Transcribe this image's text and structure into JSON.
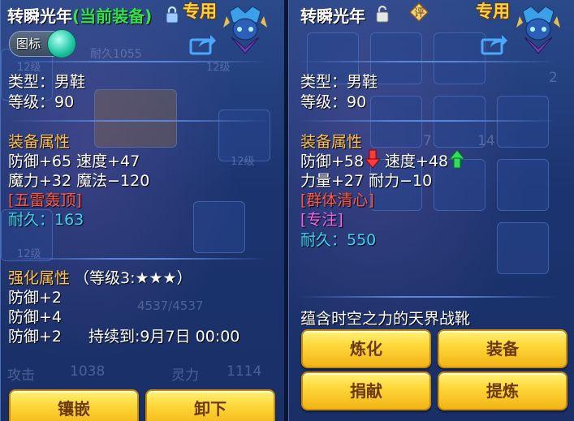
{
  "left_panel": {
    "item_name": "转瞬光年",
    "equipped_tag": "(当前装备)",
    "exclusive_tag": "专用",
    "icon_toggle_label": "图标",
    "type_line": "类型：男鞋",
    "level_line": "等级：90",
    "attr_title": "装备属性",
    "attr_line1": "防御+65 速度+47",
    "attr_line2": "魔力+32 魔法−120",
    "skill": "[五雷轰顶]",
    "durability": "耐久：163",
    "enhance_title": "强化属性",
    "enhance_level": "（等级3:★★★）",
    "enhance_lines": [
      "防御+2",
      "防御+4",
      "防御+2"
    ],
    "duration_text": "持续到:9月7日 00:00",
    "buttons": {
      "inlay": "镶嵌",
      "unequip": "卸下"
    },
    "background_text": [
      "12级",
      "12级",
      "12级",
      "12级",
      "4537/4537",
      "攻击",
      "1038",
      "灵力",
      "1114",
      "耐久1055"
    ]
  },
  "right_panel": {
    "item_name": "转瞬光年",
    "rate_icon_char": "评",
    "exclusive_tag": "专用",
    "type_line": "类型：男鞋",
    "level_line": "等级：90",
    "attr_title": "装备属性",
    "attr_def": "防御+58",
    "attr_spd": "速度+48",
    "attr_line2": "力量+27 耐力−10",
    "skill": "[群体清心]",
    "special": "[专注]",
    "durability": "耐久：550",
    "description": "蕴含时空之力的天界战靴",
    "buttons": {
      "refine": "炼化",
      "equip": "装备",
      "donate": "捐献",
      "extract": "提炼"
    },
    "background_text": [
      "2",
      "7",
      "14"
    ]
  },
  "colors": {
    "gold_tag": "#ffd23a",
    "green": "#32e04a",
    "section": "#ffc14a",
    "skill_red": "#ff5a4a",
    "durability_cyan": "#38d6f5",
    "special_pink": "#f068e8",
    "button_yellow": "#ffd83a"
  },
  "icons": {
    "lock": "lock-icon",
    "unlock": "unlock-icon",
    "share": "share-icon",
    "avatar": "character-avatar-icon",
    "down_arrow": "red-down-arrow-icon",
    "up_arrow": "green-up-arrow-icon"
  }
}
